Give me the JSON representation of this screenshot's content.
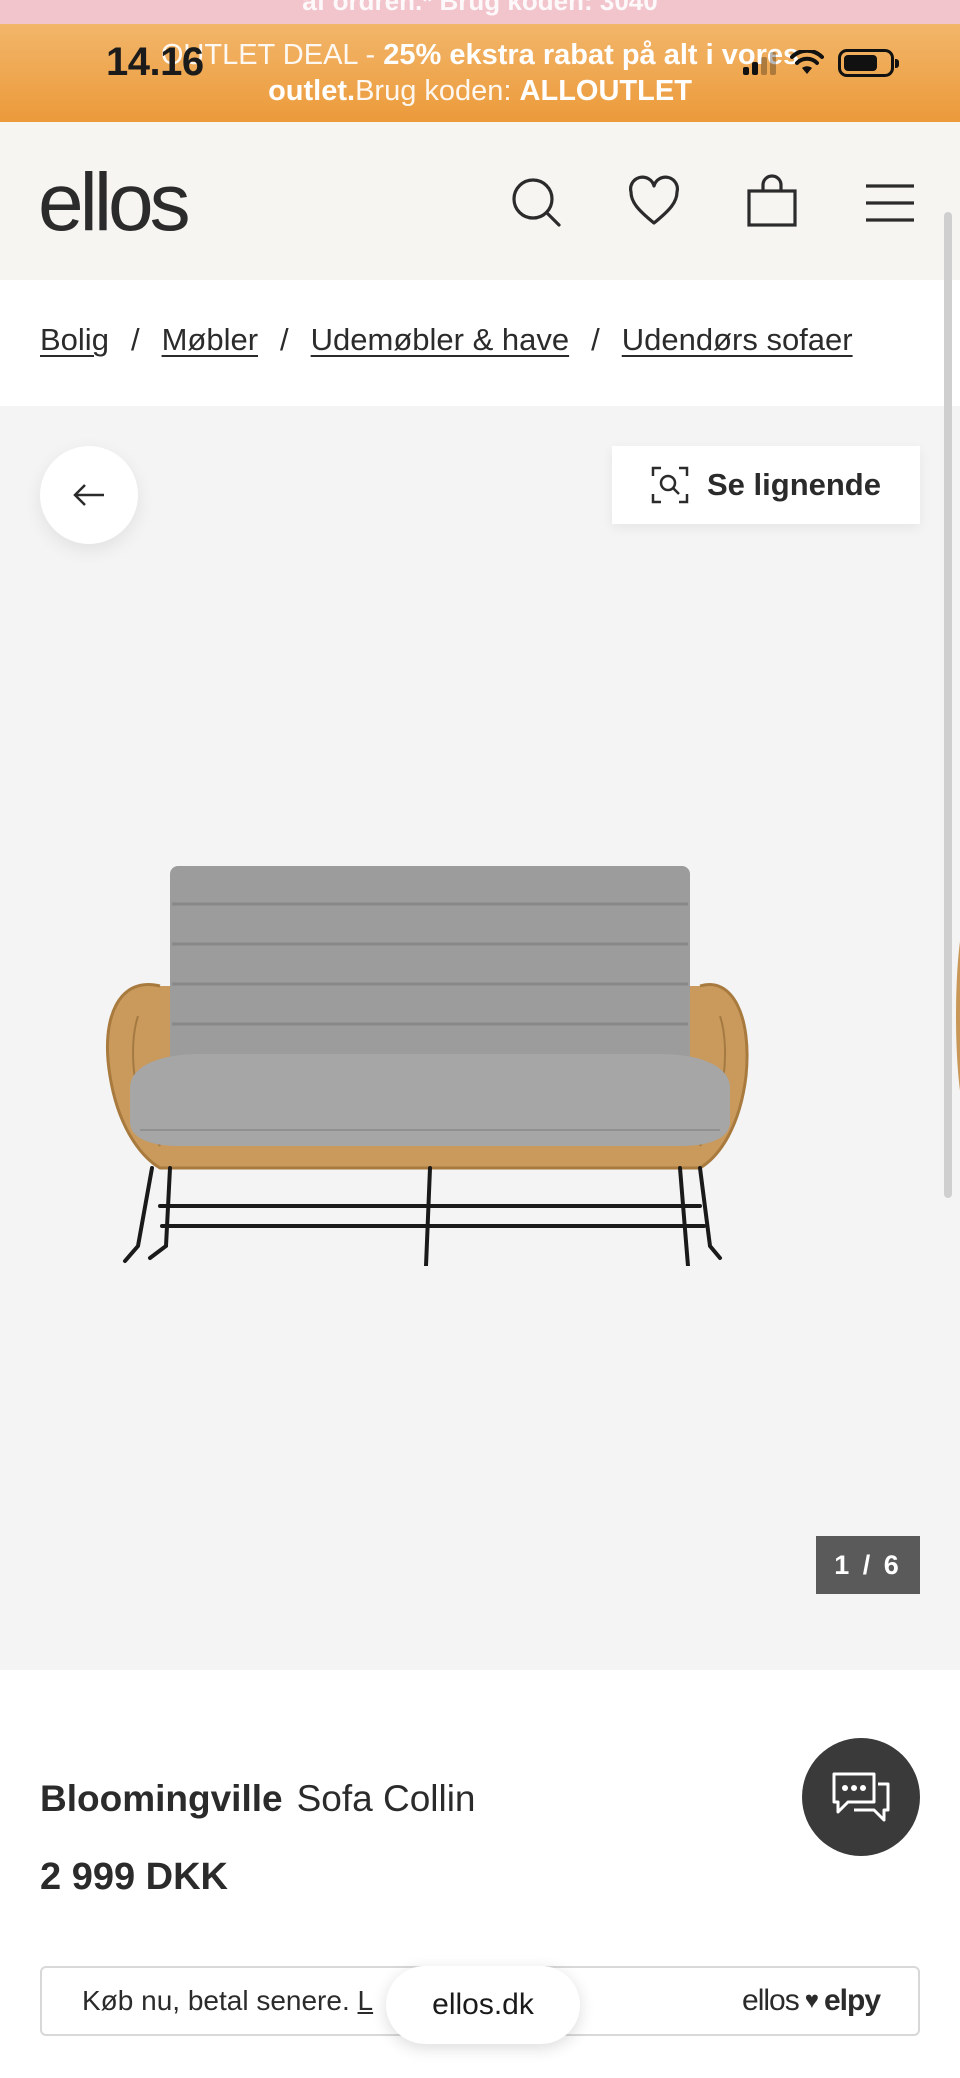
{
  "status_bar": {
    "time": "14.16"
  },
  "top_strip": {
    "text": "af ordren.* Brug koden: 3040"
  },
  "promo": {
    "prefix": "OUTLET DEAL - ",
    "bold_text": "25% ekstra rabat på alt i vores",
    "line2_bold": "outlet.",
    "line2_text": "Brug koden: ",
    "code": "ALLOUTLET"
  },
  "header": {
    "logo": "ellos",
    "icons": [
      "search-icon",
      "heart-icon",
      "bag-icon",
      "menu-icon"
    ]
  },
  "breadcrumb": {
    "items": [
      "Bolig",
      "Møbler",
      "Udemøbler & have",
      "Udendørs sofaer"
    ],
    "separator": "/"
  },
  "gallery": {
    "similar_label": "Se lignende",
    "counter": "1 / 6"
  },
  "product": {
    "brand": "Bloomingville",
    "name": "Sofa Collin",
    "price": "2 999 DKK"
  },
  "finance": {
    "text": "Køb nu, betal senere. ",
    "link": "L",
    "logo_left": "ellos",
    "logo_right": "elpy"
  },
  "browser": {
    "url": "ellos.dk"
  },
  "colors": {
    "promo": "#ec9a3a",
    "header_bg": "#f7f5f2",
    "gallery_bg": "#f4f4f4",
    "chat_button": "#3a3a3a",
    "counter_bg": "#5a5a5a"
  }
}
